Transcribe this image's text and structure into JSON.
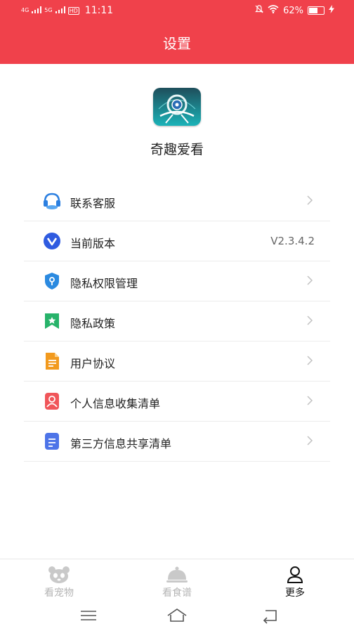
{
  "status_bar": {
    "sig1": "4G",
    "sig2": "5G",
    "hd": "HD",
    "time": "11:11",
    "battery_text": "62%",
    "battery_level": 0.62
  },
  "header": {
    "title": "设置"
  },
  "app": {
    "name": "奇趣爱看",
    "icon": "app-logo-icon"
  },
  "menu": {
    "items": [
      {
        "label": "联系客服",
        "icon": "headset-icon",
        "color": "#2b7fe0"
      },
      {
        "label": "当前版本",
        "icon": "version-icon",
        "color": "#2f5be0",
        "value": "V2.3.4.2"
      },
      {
        "label": "隐私权限管理",
        "icon": "shield-icon",
        "color": "#2b8ae0"
      },
      {
        "label": "隐私政策",
        "icon": "bookmark-icon",
        "color": "#27b36a"
      },
      {
        "label": "用户协议",
        "icon": "document-icon",
        "color": "#f29a1e"
      },
      {
        "label": "个人信息收集清单",
        "icon": "person-card-icon",
        "color": "#f0565a"
      },
      {
        "label": "第三方信息共享清单",
        "icon": "file-list-icon",
        "color": "#4d74e8"
      }
    ]
  },
  "tabs": [
    {
      "label": "看宠物",
      "icon": "panda-icon",
      "active": false
    },
    {
      "label": "看食谱",
      "icon": "cloche-icon",
      "active": false
    },
    {
      "label": "更多",
      "icon": "user-icon",
      "active": true
    }
  ],
  "system_nav": [
    "menu-icon",
    "home-icon",
    "back-icon"
  ]
}
